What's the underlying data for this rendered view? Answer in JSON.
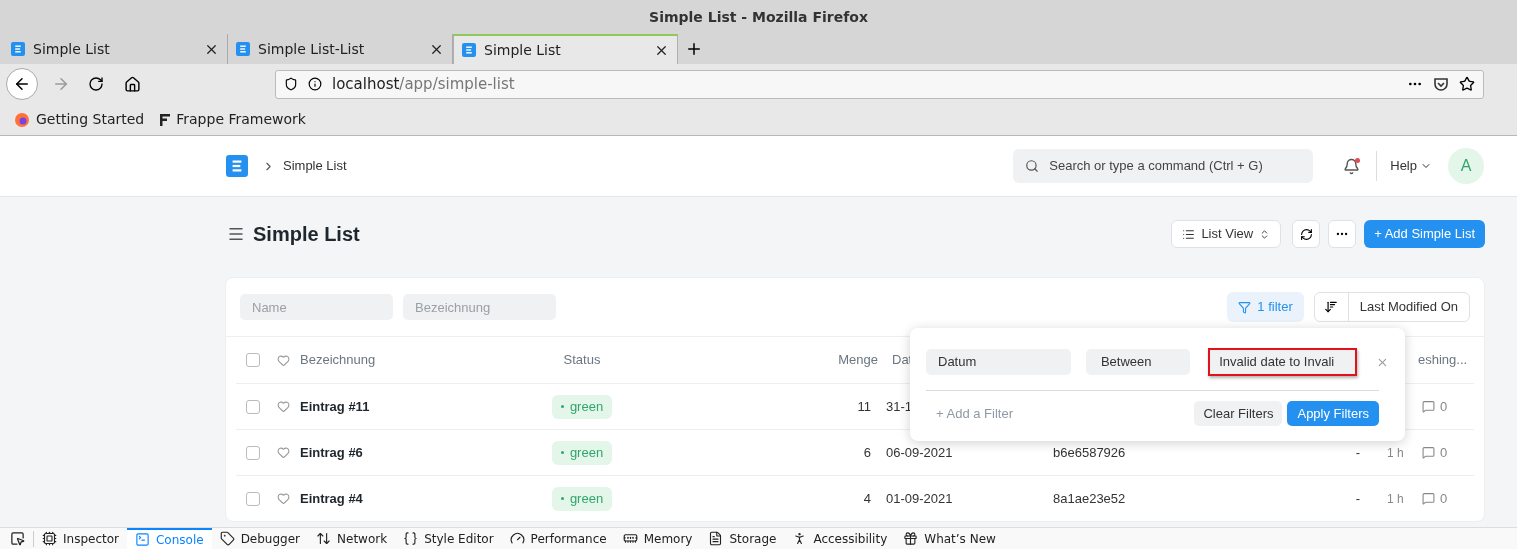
{
  "window": {
    "title": "Simple List - Mozilla Firefox"
  },
  "tabs": [
    {
      "title": "Simple List",
      "selected": false
    },
    {
      "title": "Simple List-List",
      "selected": false
    },
    {
      "title": "Simple List",
      "selected": true
    }
  ],
  "address": {
    "host": "localhost",
    "path": "/app/simple-list"
  },
  "bookmarks": [
    {
      "label": "Getting Started",
      "kind": "firefox"
    },
    {
      "label": "Frappe Framework",
      "kind": "frappe"
    }
  ],
  "navbar": {
    "breadcrumb": "Simple List",
    "search_placeholder": "Search or type a command (Ctrl + G)",
    "help": "Help",
    "avatar": "A",
    "notification": true
  },
  "page": {
    "title": "Simple List",
    "view_button": "List View",
    "add_button": "+ Add Simple List"
  },
  "list_filters": {
    "fields": [
      {
        "placeholder": "Name"
      },
      {
        "placeholder": "Bezeichnung"
      }
    ],
    "filter_button": "1 filter",
    "sort_button": "Last Modified On"
  },
  "table": {
    "select_all_checked": false,
    "columns": [
      "Bezeichnung",
      "Status",
      "Menge",
      "Dat",
      "eshing..."
    ],
    "rows": [
      {
        "checked": false,
        "name": "Eintrag #11",
        "status": "green",
        "menge": "11",
        "date": "31-1",
        "comments": "0"
      },
      {
        "checked": false,
        "name": "Eintrag #6",
        "status": "green",
        "menge": "6",
        "date": "06-09-2021",
        "id": "b6e6587926",
        "dash": "-",
        "time": "1 h",
        "comments": "0"
      },
      {
        "checked": false,
        "name": "Eintrag #4",
        "status": "green",
        "menge": "4",
        "date": "01-09-2021",
        "id": "8a1ae23e52",
        "dash": "-",
        "time": "1 h",
        "comments": "0"
      }
    ]
  },
  "filter_popup": {
    "field": "Datum",
    "condition": "Between",
    "value": "Invalid date to Invali",
    "value_highlighted": true,
    "add": "+ Add a Filter",
    "clear": "Clear Filters",
    "apply": "Apply Filters"
  },
  "devtools": [
    {
      "label": "Inspector",
      "kind": "chip",
      "selected": false
    },
    {
      "label": "Console",
      "kind": "console",
      "selected": true
    },
    {
      "label": "Debugger",
      "kind": "tag",
      "selected": false
    },
    {
      "label": "Network",
      "kind": "arrows",
      "selected": false
    },
    {
      "label": "Style Editor",
      "kind": "braces",
      "selected": false
    },
    {
      "label": "Performance",
      "kind": "gauge",
      "selected": false
    },
    {
      "label": "Memory",
      "kind": "memory",
      "selected": false
    },
    {
      "label": "Storage",
      "kind": "storage",
      "selected": false
    },
    {
      "label": "Accessibility",
      "kind": "person",
      "selected": false
    },
    {
      "label": "What’s New",
      "kind": "gift",
      "selected": false
    }
  ]
}
